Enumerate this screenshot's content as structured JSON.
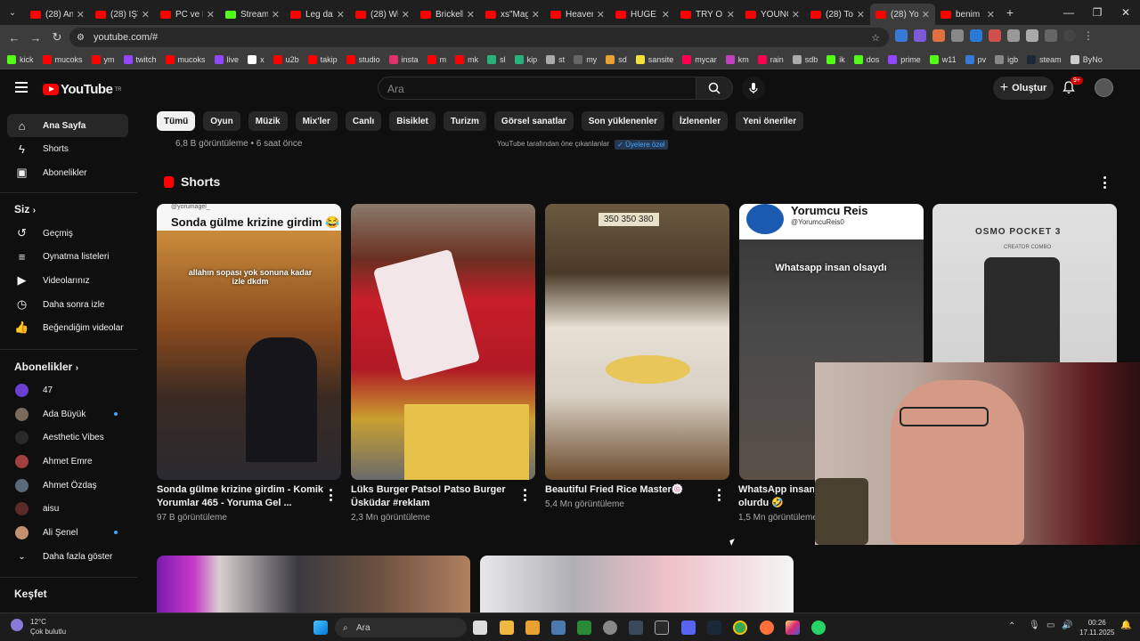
{
  "browser": {
    "tabs": [
      {
        "label": "(28) An",
        "icon": "youtube"
      },
      {
        "label": "(28) İŞT",
        "icon": "youtube"
      },
      {
        "label": "PC ve K",
        "icon": "youtube"
      },
      {
        "label": "Stream",
        "icon": "kick"
      },
      {
        "label": "Leg day",
        "icon": "youtube"
      },
      {
        "label": "(28) Wi",
        "icon": "youtube"
      },
      {
        "label": "Brickell",
        "icon": "youtube"
      },
      {
        "label": "xs\"Mag",
        "icon": "youtube"
      },
      {
        "label": "Heaven",
        "icon": "youtube"
      },
      {
        "label": "HUGE I",
        "icon": "youtube"
      },
      {
        "label": "TRY ON",
        "icon": "youtube"
      },
      {
        "label": "YOUNG",
        "icon": "youtube"
      },
      {
        "label": "(28) To",
        "icon": "youtube"
      },
      {
        "label": "(28) Yo",
        "icon": "youtube",
        "active": true
      },
      {
        "label": "benim",
        "icon": "youtube"
      }
    ],
    "url": "youtube.com/#",
    "bookmarks": [
      "kick",
      "mucoks",
      "ym",
      "twitch",
      "mucoks",
      "live",
      "x",
      "u2b",
      "takip",
      "studio",
      "insta",
      "m",
      "mk",
      "sl",
      "kip",
      "st",
      "my",
      "sd",
      "sansite",
      "mycar",
      "km",
      "rain",
      "sdb",
      "ik",
      "dos",
      "prime",
      "w11",
      "pv",
      "igb",
      "steam",
      "ByNo"
    ]
  },
  "header": {
    "logo_text": "YouTube",
    "logo_sup": "TR",
    "search_placeholder": "Ara",
    "create_label": "Oluştur",
    "notif_count": "9+"
  },
  "sidebar": {
    "main": [
      {
        "label": "Ana Sayfa",
        "icon": "home-icon"
      },
      {
        "label": "Shorts",
        "icon": "shorts-icon"
      },
      {
        "label": "Abonelikler",
        "icon": "subscriptions-icon"
      }
    ],
    "you_header": "Siz",
    "you": [
      {
        "label": "Geçmiş",
        "icon": "history-icon"
      },
      {
        "label": "Oynatma listeleri",
        "icon": "playlists-icon"
      },
      {
        "label": "Videolarınız",
        "icon": "your-videos-icon"
      },
      {
        "label": "Daha sonra izle",
        "icon": "watch-later-icon"
      },
      {
        "label": "Beğendiğim videolar",
        "icon": "liked-videos-icon"
      }
    ],
    "subs_header": "Abonelikler",
    "subs": [
      {
        "label": "47",
        "color": "#6a3fd1",
        "dot": false
      },
      {
        "label": "Ada Büyük",
        "color": "#7a6a5a",
        "dot": true
      },
      {
        "label": "Aesthetic Vibes",
        "color": "#2a2a2a",
        "dot": false
      },
      {
        "label": "Ahmet Emre",
        "color": "#a04040",
        "dot": false
      },
      {
        "label": "Ahmet Özdaş",
        "color": "#5a6a7a",
        "dot": false
      },
      {
        "label": "aisu",
        "color": "#5a2a2a",
        "dot": false
      },
      {
        "label": "Ali Şenel",
        "color": "#c09070",
        "dot": true
      }
    ],
    "more_label": "Daha fazla göster",
    "explore_header": "Keşfet"
  },
  "chips": [
    "Tümü",
    "Oyun",
    "Müzik",
    "Mix'ler",
    "Canlı",
    "Bisiklet",
    "Turizm",
    "Görsel sanatlar",
    "Son yüklenenler",
    "İzlenenler",
    "Yeni öneriler"
  ],
  "prev_video_meta": "6,8 B görüntüleme • 6 saat önce",
  "featured": {
    "label": "YouTube tarafından öne çıkanlanlar",
    "members": "Üyelere özel"
  },
  "shorts": {
    "title": "Shorts",
    "items": [
      {
        "title": "Sonda gülme krizine girdim - Komik Yorumlar 465 - Yoruma Gel ...",
        "views": "97 B görüntüleme",
        "overlay_top": "Sonda gülme krizine girdim 😂",
        "overlay_handle": "@yorumagel_",
        "overlay_mid": "allahın sopası yok sonuna kadar izle dkdm"
      },
      {
        "title": "Lüks Burger Patso! Patso Burger Üsküdar #reklam",
        "views": "2,3 Mn görüntüleme"
      },
      {
        "title": "Beautiful Fried Rice Master🍥",
        "views": "5,4 Mn görüntüleme",
        "overlay_menu": "350 350 380"
      },
      {
        "title": "WhatsApp insan olsaydı 🤣",
        "title_line1": "WhatsApp insan o",
        "title_line2": "olurdu 🤣",
        "views": "1,5 Mn görüntüleme",
        "overlay_top": "Yorumcu Reis",
        "overlay_handle": "@YorumcuReis0",
        "overlay_mid": "Whatsapp insan olsaydı"
      },
      {
        "title": "",
        "views": "",
        "overlay_brand": "OSMO POCKET 3",
        "overlay_sub": "CREATOR COMBO"
      }
    ]
  },
  "taskbar": {
    "weather_temp": "12°C",
    "weather_desc": "Çok bulutlu",
    "search_label": "Ara",
    "time": "00:26",
    "date": "17.11.2025"
  }
}
